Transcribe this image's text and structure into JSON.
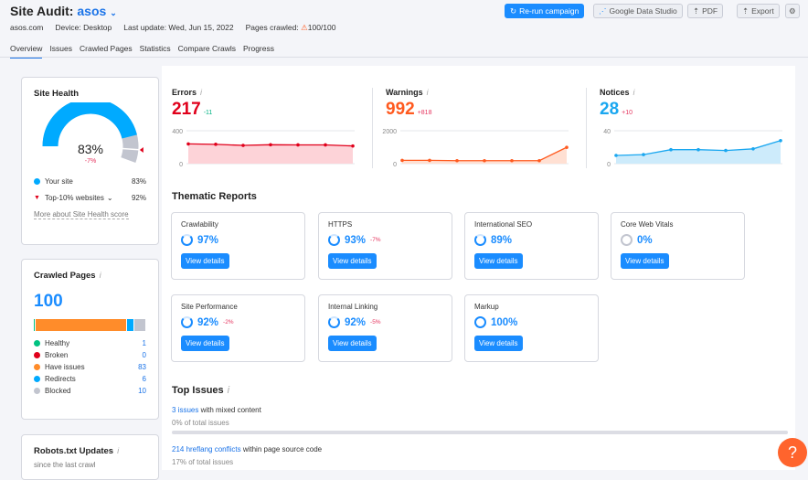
{
  "header": {
    "title": "Site Audit:",
    "project": "asos",
    "domain": "asos.com",
    "device": "Device: Desktop",
    "last_update": "Last update: Wed, Jun 15, 2022",
    "pages_crawled_label": "Pages crawled:",
    "pages_crawled": "100/100",
    "buttons": {
      "rerun": "Re-run campaign",
      "gds": "Google Data Studio",
      "pdf": "PDF",
      "export": "Export"
    }
  },
  "tabs": [
    "Overview",
    "Issues",
    "Crawled Pages",
    "Statistics",
    "Compare Crawls",
    "Progress"
  ],
  "site_health": {
    "title": "Site Health",
    "score": "83%",
    "delta": "-7%",
    "score_value": 83,
    "top10_value": 92,
    "your_site_label": "Your site",
    "your_site_value": "83%",
    "top10_label": "Top-10% websites",
    "top10_text": "92%",
    "more_link": "More about Site Health score"
  },
  "crawled_pages": {
    "title": "Crawled Pages",
    "total": "100",
    "items": [
      {
        "label": "Healthy",
        "value": "1",
        "color": "#00c281"
      },
      {
        "label": "Broken",
        "value": "0",
        "color": "#e0001b"
      },
      {
        "label": "Have issues",
        "value": "83",
        "color": "#ff8c2a"
      },
      {
        "label": "Redirects",
        "value": "6",
        "color": "#00aaff"
      },
      {
        "label": "Blocked",
        "value": "10",
        "color": "#c2c5cf"
      }
    ]
  },
  "robots": {
    "title": "Robots.txt Updates",
    "sub": "since the last crawl"
  },
  "metrics": [
    {
      "label": "Errors",
      "value": "217",
      "delta": "-11",
      "color": "#e0001b",
      "delta_color": "#00b383",
      "fill": "#fdd3d8",
      "ymax_label": "400",
      "ymin_label": "0",
      "ymax": 400,
      "series": [
        240,
        235,
        222,
        230,
        228,
        228,
        215
      ]
    },
    {
      "label": "Warnings",
      "value": "992",
      "delta": "+818",
      "color": "#ff5a1f",
      "delta_color": "#e5355f",
      "fill": "#ffe0d3",
      "ymax_label": "2000",
      "ymin_label": "0",
      "ymax": 2000,
      "series": [
        200,
        200,
        180,
        180,
        180,
        180,
        992
      ]
    },
    {
      "label": "Notices",
      "value": "28",
      "delta": "+10",
      "color": "#1aa7f0",
      "delta_color": "#e5355f",
      "fill": "#cdebfb",
      "ymax_label": "40",
      "ymin_label": "0",
      "ymax": 40,
      "series": [
        10,
        11,
        17,
        17,
        16,
        18,
        28
      ]
    }
  ],
  "thematic": {
    "title": "Thematic Reports",
    "button": "View details",
    "items": [
      {
        "name": "Crawlability",
        "pct": "97%",
        "delta": "",
        "value": 97
      },
      {
        "name": "HTTPS",
        "pct": "93%",
        "delta": "-7%",
        "value": 93
      },
      {
        "name": "International SEO",
        "pct": "89%",
        "delta": "",
        "value": 89
      },
      {
        "name": "Core Web Vitals",
        "pct": "0%",
        "delta": "",
        "value": 0
      },
      {
        "name": "Site Performance",
        "pct": "92%",
        "delta": "-2%",
        "value": 92
      },
      {
        "name": "Internal Linking",
        "pct": "92%",
        "delta": "-5%",
        "value": 92
      },
      {
        "name": "Markup",
        "pct": "100%",
        "delta": "",
        "value": 100
      }
    ]
  },
  "top_issues": {
    "title": "Top Issues",
    "items": [
      {
        "link": "3 issues",
        "text": " with mixed content",
        "share": "0% of total issues",
        "share_value": 0
      },
      {
        "link": "214 hreflang conflicts",
        "text": " within page source code",
        "share": "17% of total issues",
        "share_value": 17
      }
    ]
  },
  "help": "?"
}
